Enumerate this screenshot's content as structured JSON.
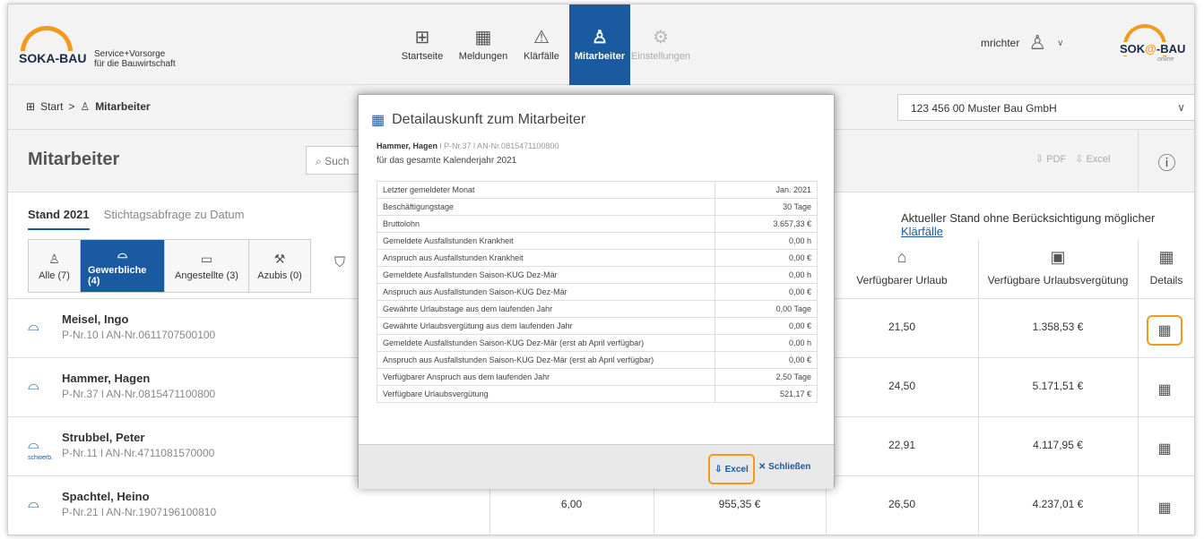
{
  "header": {
    "brand": "SOKA-BAU",
    "tagline1": "Service+Vorsorge",
    "tagline2": "für die Bauwirtschaft",
    "nav": [
      {
        "label": "Startseite",
        "icon": "grid-icon"
      },
      {
        "label": "Meldungen",
        "icon": "calendar-icon"
      },
      {
        "label": "Klärfälle",
        "icon": "warning-icon"
      },
      {
        "label": "Mitarbeiter",
        "icon": "users-icon"
      },
      {
        "label": "Einstellungen",
        "icon": "gear-icon"
      }
    ],
    "user": "mrichter",
    "right_brand_a": "SOK",
    "right_brand_at": "@",
    "right_brand_b": "-BAU",
    "right_brand_online": "online"
  },
  "breadcrumb": {
    "start": "Start",
    "sep": ">",
    "current": "Mitarbeiter"
  },
  "company_select": "123 456 00 Muster Bau GmbH",
  "page": {
    "title": "Mitarbeiter",
    "search_placeholder": "Such",
    "pdf": "PDF",
    "excel": "Excel"
  },
  "tabs": {
    "active": "Stand 2021",
    "other": "Stichtagsabfrage zu Datum"
  },
  "notice": {
    "text": "Aktueller Stand ohne Berücksichtigung möglicher ",
    "link": "Klärfälle"
  },
  "filters": [
    {
      "label": "Alle (7)",
      "active": false
    },
    {
      "label": "Gewerbliche (4)",
      "active": true
    },
    {
      "label": "Angestellte (3)",
      "active": false
    },
    {
      "label": "Azubis (0)",
      "active": false
    }
  ],
  "columns": {
    "urlaub": "Verfügbarer Urlaub",
    "verguetung": "Verfügbare Urlaubsvergütung",
    "details": "Details"
  },
  "rows": [
    {
      "name": "Meisel, Ingo",
      "pnr": "P-Nr.10 l AN-Nr.0611707500100",
      "badge": "",
      "c1": "",
      "c2": "",
      "urlaub": "21,50",
      "verguetung": "1.358,53 €"
    },
    {
      "name": "Hammer, Hagen",
      "pnr": "P-Nr.37 l AN-Nr.0815471100800",
      "badge": "",
      "c1": "",
      "c2": "",
      "urlaub": "24,50",
      "verguetung": "5.171,51 €"
    },
    {
      "name": "Strubbel, Peter",
      "pnr": "P-Nr.11 l AN-Nr.4711081570000",
      "badge": "schwerb.",
      "c1": "",
      "c2": "",
      "urlaub": "22,91",
      "verguetung": "4.117,95 €"
    },
    {
      "name": "Spachtel, Heino",
      "pnr": "P-Nr.21 l AN-Nr.1907196100810",
      "badge": "",
      "c1": "6,00",
      "c2": "955,35 €",
      "urlaub": "26,50",
      "verguetung": "4.237,01 €"
    }
  ],
  "modal": {
    "title": "Detailauskunft zum Mitarbeiter",
    "name": "Hammer, Hagen",
    "meta": "l P-Nr.37 l AN-Nr.0815471100800",
    "subtitle": "für das gesamte Kalenderjahr 2021",
    "rows": [
      [
        "Letzter gemeldeter Monat",
        "Jan. 2021"
      ],
      [
        "Beschäftigungstage",
        "30 Tage"
      ],
      [
        "Bruttolohn",
        "3.657,33 €"
      ],
      [
        "Gemeldete Ausfallstunden Krankheit",
        "0,00 h"
      ],
      [
        "Anspruch aus Ausfallstunden Krankheit",
        "0,00 €"
      ],
      [
        "Gemeldete Ausfallstunden Saison-KUG Dez-Mär",
        "0,00 h"
      ],
      [
        "Anspruch aus Ausfallstunden Saison-KUG Dez-Mär",
        "0,00 €"
      ],
      [
        "Gewährte Urlaubstage aus dem laufenden Jahr",
        "0,00 Tage"
      ],
      [
        "Gewährte Urlaubsvergütung aus dem laufenden Jahr",
        "0,00 €"
      ],
      [
        "Gemeldete Ausfallstunden Saison-KUG Dez-Mär (erst ab April verfügbar)",
        "0,00 h"
      ],
      [
        "Anspruch aus Ausfallstunden Saison-KUG Dez-Mär (erst ab April verfügbar)",
        "0,00 €"
      ],
      [
        "Verfügbarer Anspruch aus dem laufenden Jahr",
        "2,50 Tage"
      ],
      [
        "Verfügbare Urlaubsvergütung",
        "521,17 €"
      ]
    ],
    "excel": "Excel",
    "close": "Schließen"
  }
}
